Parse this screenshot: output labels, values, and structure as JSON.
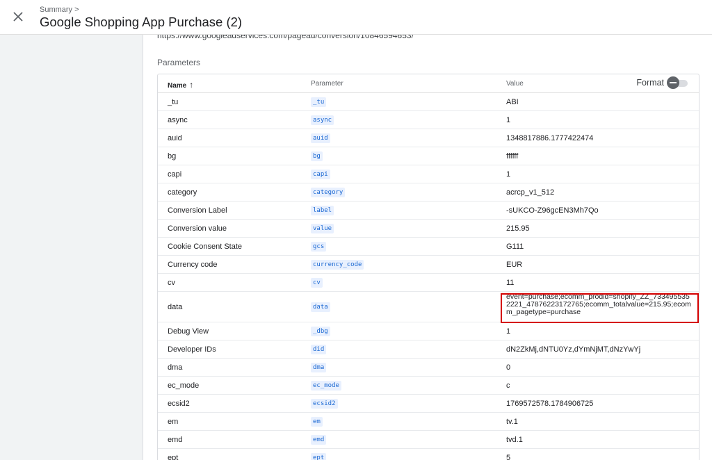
{
  "header": {
    "breadcrumb": "Summary >",
    "title": "Google Shopping App Purchase (2)",
    "close_icon": "close-icon"
  },
  "main": {
    "url": "https://www.googleadservices.com/pagead/conversion/10846594653/",
    "section_title": "Parameters",
    "table": {
      "columns": {
        "name": "Name",
        "parameter": "Parameter",
        "value": "Value"
      },
      "sort_icon": "arrow-up-icon",
      "format_label": "Format",
      "format_enabled": false,
      "rows": [
        {
          "name": "_tu",
          "param": "_tu",
          "value": "ABI"
        },
        {
          "name": "async",
          "param": "async",
          "value": "1"
        },
        {
          "name": "auid",
          "param": "auid",
          "value": "1348817886.1777422474"
        },
        {
          "name": "bg",
          "param": "bg",
          "value": "ffffff"
        },
        {
          "name": "capi",
          "param": "capi",
          "value": "1"
        },
        {
          "name": "category",
          "param": "category",
          "value": "acrcp_v1_512"
        },
        {
          "name": "Conversion Label",
          "param": "label",
          "value": "-sUKCO-Z96gcEN3Mh7Qo"
        },
        {
          "name": "Conversion value",
          "param": "value",
          "value": "215.95"
        },
        {
          "name": "Cookie Consent State",
          "param": "gcs",
          "value": "G111"
        },
        {
          "name": "Currency code",
          "param": "currency_code",
          "value": "EUR"
        },
        {
          "name": "cv",
          "param": "cv",
          "value": "11"
        },
        {
          "name": "data",
          "param": "data",
          "value": "event=purchase;ecomm_prodid=shopify_ZZ_7334955352221_47876223172765;ecomm_totalvalue=215.95;ecomm_pagetype=purchase"
        },
        {
          "name": "Debug View",
          "param": "_dbg",
          "value": "1"
        },
        {
          "name": "Developer IDs",
          "param": "did",
          "value": "dN2ZkMj,dNTU0Yz,dYmNjMT,dNzYwYj"
        },
        {
          "name": "dma",
          "param": "dma",
          "value": "0"
        },
        {
          "name": "ec_mode",
          "param": "ec_mode",
          "value": "c"
        },
        {
          "name": "ecsid2",
          "param": "ecsid2",
          "value": "1769572578.1784906725"
        },
        {
          "name": "em",
          "param": "em",
          "value": "tv.1"
        },
        {
          "name": "emd",
          "param": "emd",
          "value": "tvd.1"
        },
        {
          "name": "ept",
          "param": "ept",
          "value": "5"
        }
      ]
    },
    "highlight_color": "#d50000"
  }
}
